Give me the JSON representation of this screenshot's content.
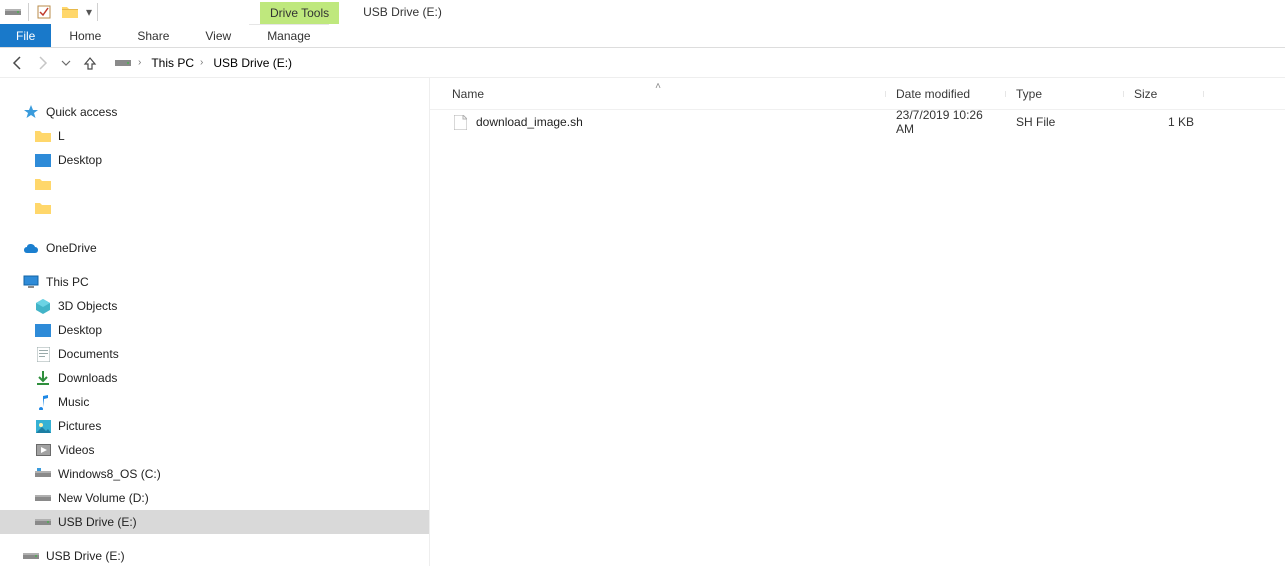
{
  "window": {
    "title": "USB Drive (E:)",
    "tool_tab": "Drive Tools"
  },
  "ribbon": {
    "file": "File",
    "home": "Home",
    "share": "Share",
    "view": "View",
    "manage": "Manage"
  },
  "breadcrumbs": {
    "pc": "This PC",
    "location": "USB Drive (E:)"
  },
  "tree": {
    "quick_access": "Quick access",
    "qa_item1": "L",
    "desktop": "Desktop",
    "qa_item2": " ",
    "qa_item3": " ",
    "onedrive": "OneDrive",
    "this_pc": "This PC",
    "objects3d": "3D Objects",
    "tp_desktop": "Desktop",
    "documents": "Documents",
    "downloads": "Downloads",
    "music": "Music",
    "pictures": "Pictures",
    "videos": "Videos",
    "drive_c": "Windows8_OS (C:)",
    "drive_d": "New Volume (D:)",
    "drive_e": "USB Drive (E:)",
    "drive_e_ext": "USB Drive (E:)"
  },
  "columns": {
    "name": "Name",
    "date": "Date modified",
    "type": "Type",
    "size": "Size"
  },
  "files": [
    {
      "name": "download_image.sh",
      "date": "23/7/2019 10:26 AM",
      "type": "SH File",
      "size": "1 KB"
    }
  ]
}
